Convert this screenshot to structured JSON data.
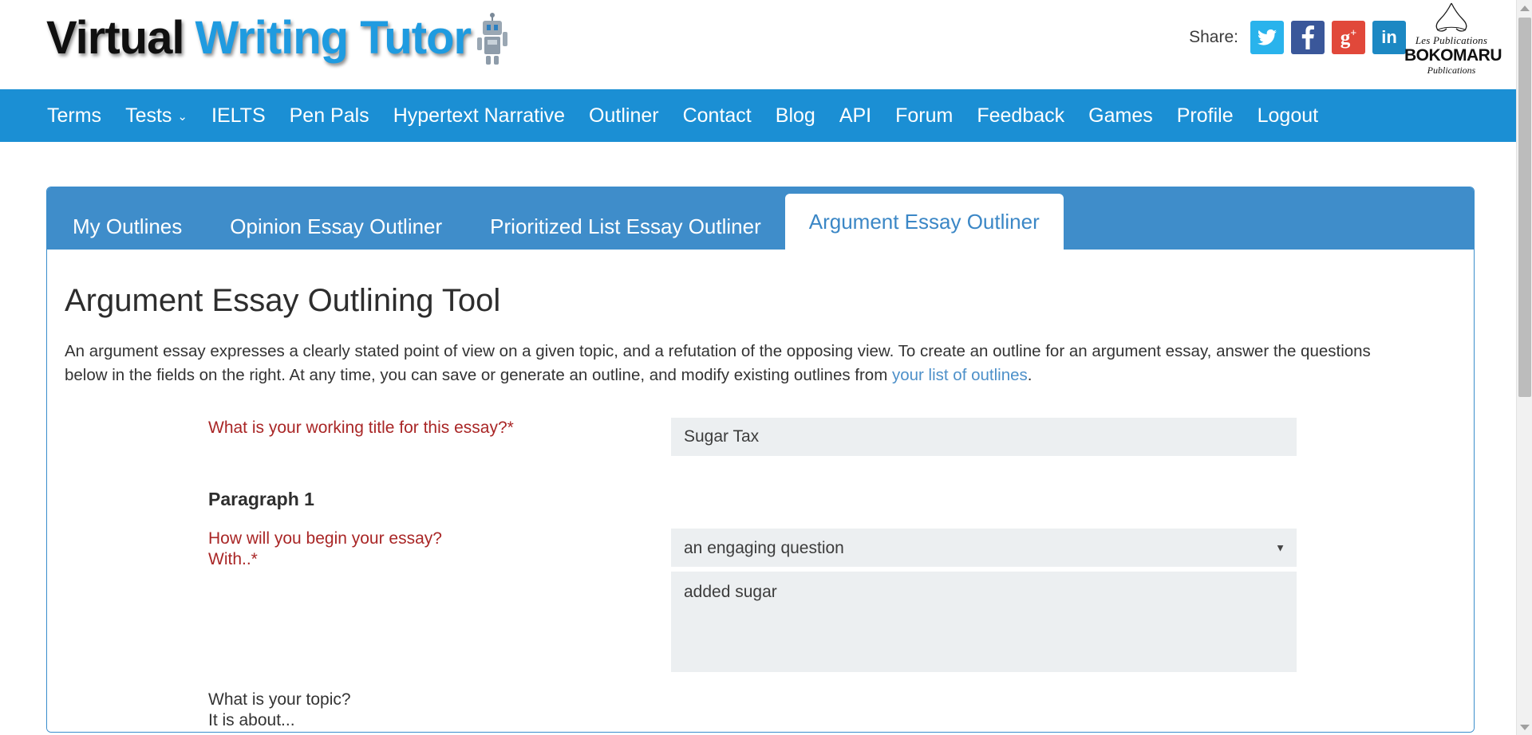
{
  "header": {
    "logo": {
      "word1": "Virtual",
      "word2": "Writing Tutor",
      "robot_icon": "robot-icon"
    },
    "share": {
      "label": "Share:",
      "buttons": [
        {
          "name": "twitter-share-icon",
          "glyph": "🐦",
          "color": "#29b3ec"
        },
        {
          "name": "facebook-share-icon",
          "glyph": "f",
          "color": "#3a579a"
        },
        {
          "name": "googleplus-share-icon",
          "glyph": "g+",
          "color": "#e1483a"
        },
        {
          "name": "linkedin-share-icon",
          "glyph": "in",
          "color": "#1c88c3"
        }
      ]
    },
    "publisher": {
      "line1": "Les Publications",
      "line2": "BOKOMARU",
      "line3": "Publications"
    }
  },
  "nav": {
    "background": "#1b8fd4",
    "items": [
      {
        "label": "Terms",
        "has_caret": false
      },
      {
        "label": "Tests",
        "has_caret": true,
        "caret": "⌄"
      },
      {
        "label": "IELTS",
        "has_caret": false
      },
      {
        "label": "Pen Pals",
        "has_caret": false
      },
      {
        "label": "Hypertext Narrative",
        "has_caret": false
      },
      {
        "label": "Outliner",
        "has_caret": false
      },
      {
        "label": "Contact",
        "has_caret": false
      },
      {
        "label": "Blog",
        "has_caret": false
      },
      {
        "label": "API",
        "has_caret": false
      },
      {
        "label": "Forum",
        "has_caret": false
      },
      {
        "label": "Feedback",
        "has_caret": false
      },
      {
        "label": "Games",
        "has_caret": false
      },
      {
        "label": "Profile",
        "has_caret": false
      },
      {
        "label": "Logout",
        "has_caret": false
      }
    ]
  },
  "panel": {
    "tabs": [
      {
        "label": "My Outlines",
        "active": false
      },
      {
        "label": "Opinion Essay Outliner",
        "active": false
      },
      {
        "label": "Prioritized List Essay Outliner",
        "active": false
      },
      {
        "label": "Argument Essay Outliner",
        "active": true
      }
    ],
    "title": "Argument Essay Outlining Tool",
    "intro": {
      "text_before": "An argument essay expresses a clearly stated point of view on a given topic, and a refutation of the opposing view. To create an outline for an argument essay, answer the questions below in the fields on the right. At any time, you can save or generate an outline, and modify existing outlines from ",
      "link": "your list of outlines",
      "text_after": "."
    },
    "form": {
      "title_question": "What is your working title for this essay?*",
      "title_value": "Sugar Tax",
      "paragraph1_heading": "Paragraph 1",
      "begin_question_line1": "How will you begin your essay?",
      "begin_question_line2": "With..*",
      "begin_select_value": "an engaging question",
      "begin_select_caret": "▼",
      "begin_textarea_value": "added sugar",
      "topic_question_line1": "What is your topic?",
      "topic_question_line2": "It is about..."
    }
  },
  "scrollbar": {
    "up_arrow": "scroll-up-arrow",
    "down_arrow": "scroll-down-arrow",
    "thumb": "scroll-thumb"
  }
}
